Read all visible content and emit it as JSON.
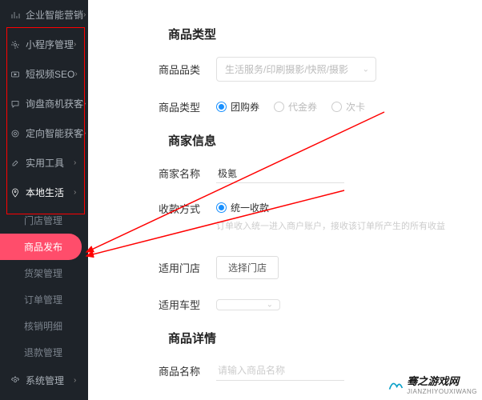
{
  "sidebar": {
    "items": [
      {
        "label": "企业智能营销",
        "icon": "chart"
      },
      {
        "label": "小程序管理",
        "icon": "gear"
      },
      {
        "label": "短视频SEO",
        "icon": "video"
      },
      {
        "label": "询盘商机获客",
        "icon": "message"
      },
      {
        "label": "定向智能获客",
        "icon": "target"
      },
      {
        "label": "实用工具",
        "icon": "tool"
      }
    ],
    "local_life": {
      "label": "本地生活",
      "children": [
        {
          "label": "门店管理"
        },
        {
          "label": "商品发布",
          "active": true
        },
        {
          "label": "货架管理"
        },
        {
          "label": "订单管理"
        },
        {
          "label": "核销明细"
        },
        {
          "label": "退款管理"
        }
      ]
    },
    "system": {
      "label": "系统管理"
    }
  },
  "main": {
    "section1_title": "商品类型",
    "category_label": "商品品类",
    "category_placeholder": "生活服务/印刷摄影/快照/摄影",
    "type_label": "商品类型",
    "type_options": [
      "团购券",
      "代金券",
      "次卡"
    ],
    "section2_title": "商家信息",
    "merchant_name_label": "商家名称",
    "merchant_name_value": "极氪",
    "payment_label": "收款方式",
    "payment_options": [
      "统一收款"
    ],
    "payment_hint": "订单收入统一进入商户账户，接收该订单所产生的所有收益",
    "store_label": "适用门店",
    "store_button": "选择门店",
    "vehicle_label": "适用车型",
    "section3_title": "商品详情",
    "product_name_label": "商品名称",
    "product_name_placeholder": "请输入商品名称"
  },
  "watermark": {
    "text": "骞之游戏网",
    "sub": "JIANZHIYOUXIWANG"
  }
}
